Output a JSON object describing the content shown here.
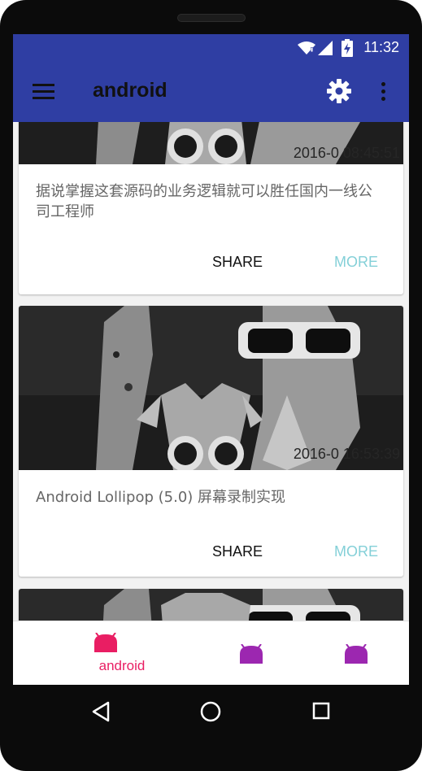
{
  "status_bar": {
    "time": "11:32"
  },
  "toolbar": {
    "title": "android"
  },
  "cards": [
    {
      "timestamp": "2016-0   08:45:51",
      "text": "据说掌握这套源码的业务逻辑就可以胜任国内一线公司工程师",
      "share": "SHARE",
      "more": "MORE"
    },
    {
      "timestamp": "2016-0   16:53:39",
      "text": "Android Lollipop (5.0) 屏幕录制实现",
      "share": "SHARE",
      "more": "MORE"
    }
  ],
  "bottom_nav": {
    "items": [
      {
        "label": "android",
        "color": "#e91e63"
      },
      {
        "label": "",
        "color": "#9c27b0"
      },
      {
        "label": "",
        "color": "#9c27b0"
      }
    ]
  },
  "colors": {
    "primary": "#2f3ea3",
    "accent": "#e91e63",
    "secondary_icon": "#9c27b0",
    "more_text": "#84d0d8"
  }
}
